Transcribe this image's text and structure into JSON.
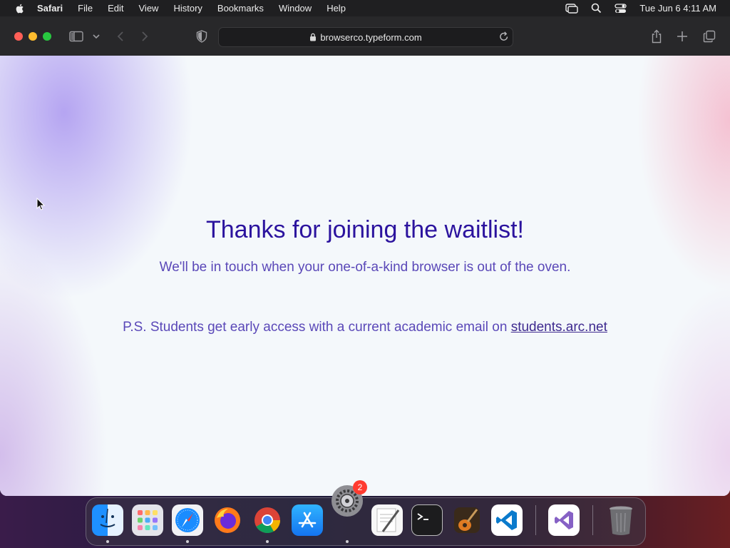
{
  "menubar": {
    "app": "Safari",
    "items": [
      "File",
      "Edit",
      "View",
      "History",
      "Bookmarks",
      "Window",
      "Help"
    ],
    "clock": "Tue Jun 6  4:11 AM"
  },
  "browser": {
    "url": "browserco.typeform.com"
  },
  "page": {
    "headline": "Thanks for joining the waitlist!",
    "subtext": "We'll be in touch when your one-of-a-kind browser is out of the oven.",
    "ps_text": "P.S. Students get early access with a current academic email on ",
    "ps_link": "students.arc.net"
  },
  "dock": {
    "settings_badge": "2",
    "apps": [
      "finder-icon",
      "launchpad-icon",
      "safari-icon",
      "firefox-icon",
      "chrome-icon",
      "app-store-icon",
      "system-settings-icon",
      "textedit-icon",
      "terminal-icon",
      "garageband-icon",
      "vscode-icon",
      "visual-studio-icon",
      "trash-icon"
    ]
  },
  "colors": {
    "headline": "#2b139e",
    "body_text": "#5a48b8",
    "toolbar": "#28282a"
  }
}
